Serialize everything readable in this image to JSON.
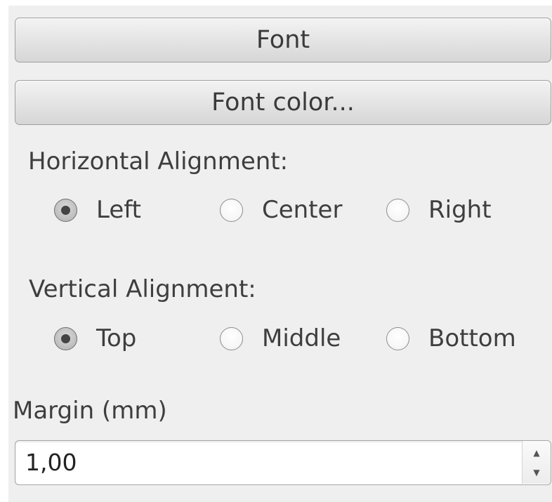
{
  "buttons": {
    "font_label": "Font",
    "font_color_label": "Font color..."
  },
  "horizontal_alignment": {
    "label": "Horizontal Alignment:",
    "options": [
      "Left",
      "Center",
      "Right"
    ],
    "selected": "Left"
  },
  "vertical_alignment": {
    "label": "Vertical Alignment:",
    "options": [
      "Top",
      "Middle",
      "Bottom"
    ],
    "selected": "Top"
  },
  "margin": {
    "label": "Margin (mm)",
    "value": "1,00",
    "up_icon": "spin-up-icon",
    "down_icon": "spin-down-icon"
  },
  "colors": {
    "panel_bg": "#efefef",
    "text": "#3e3e3e"
  }
}
